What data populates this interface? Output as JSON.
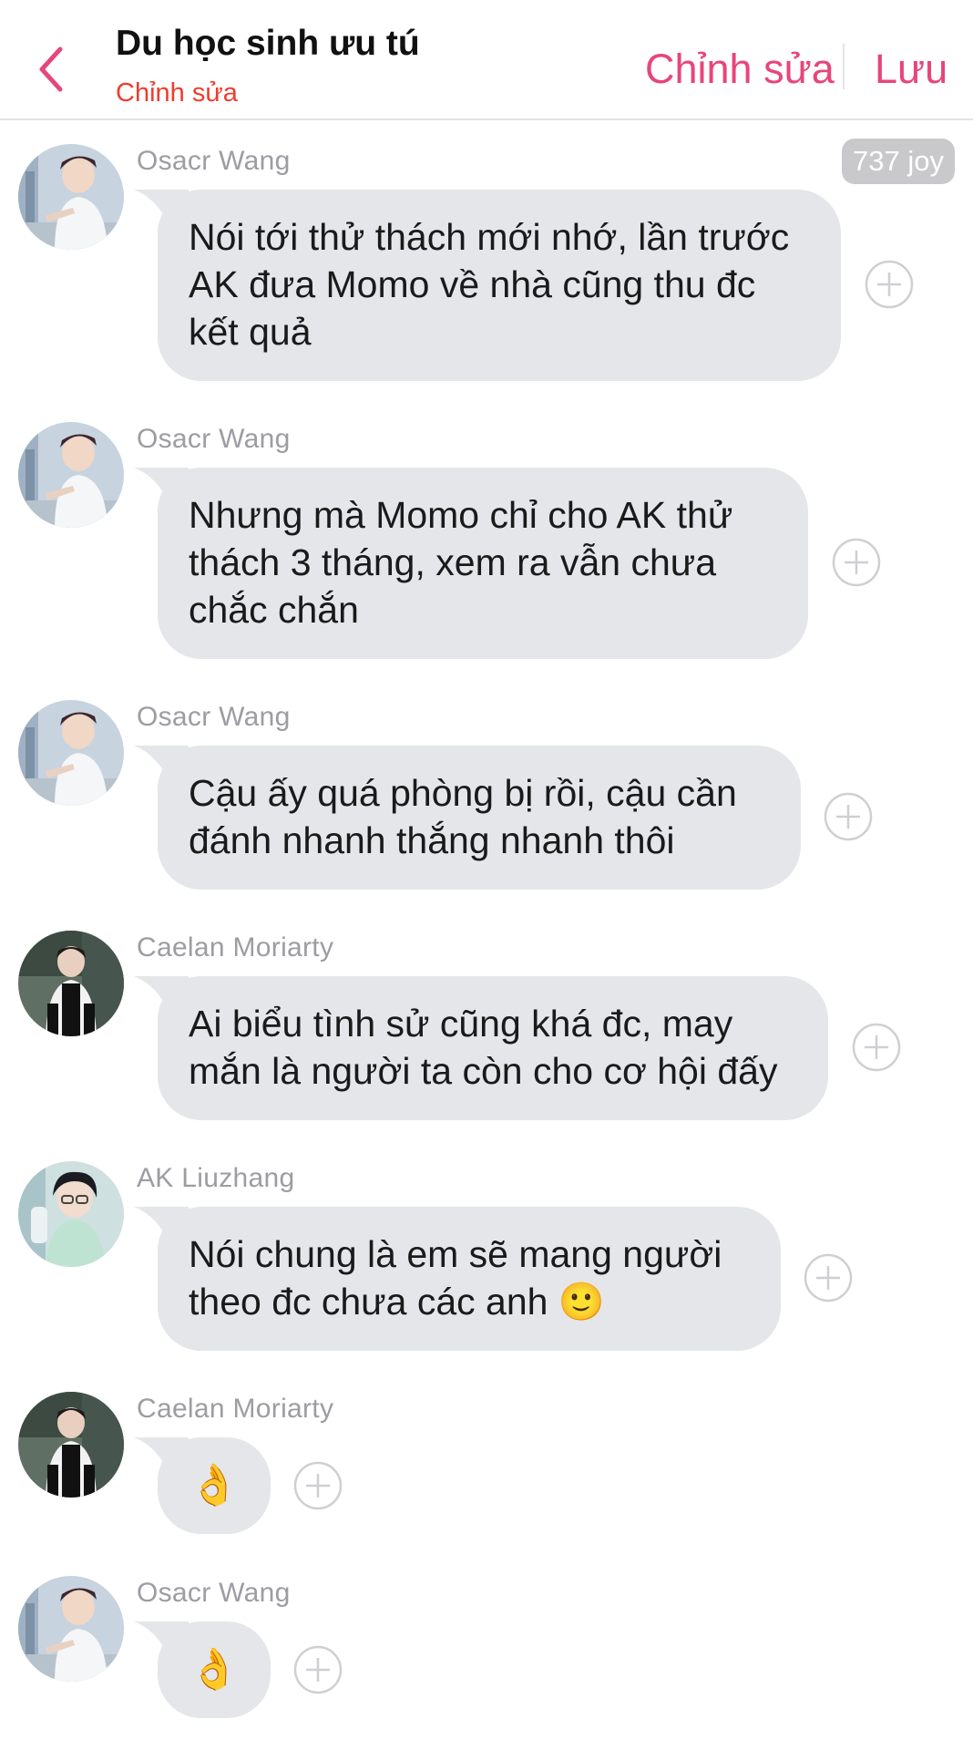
{
  "header": {
    "title": "Du học sinh ưu tú",
    "subtitle": "Chỉnh sửa",
    "edit_label": "Chỉnh sửa",
    "save_label": "Lưu",
    "back_icon": "chevron-left-icon",
    "accent": "#e8457a"
  },
  "joy_badge": "737 joy",
  "messages": [
    {
      "sender": "Osacr Wang",
      "text": "Nói tới thử thách mới nhớ, lần trước AK đưa Momo về nhà cũng thu đc kết quả",
      "avatar": "osacr"
    },
    {
      "sender": "Osacr Wang",
      "text": "Nhưng mà  Momo chỉ cho AK thử thách 3 tháng, xem ra vẫn chưa chắc chắn",
      "avatar": "osacr"
    },
    {
      "sender": "Osacr Wang",
      "text": "Cậu ấy quá phòng bị rồi, cậu cần đánh nhanh thắng nhanh thôi",
      "avatar": "osacr"
    },
    {
      "sender": "Caelan Moriarty",
      "text": "Ai biểu tình sử cũng khá đc, may mắn là người ta còn cho cơ hội đấy",
      "avatar": "caelan"
    },
    {
      "sender": "AK Liuzhang",
      "text": "Nói chung là em sẽ mang người theo đc chưa các anh 🙂",
      "avatar": "ak"
    },
    {
      "sender": "Caelan Moriarty",
      "text": "👌",
      "avatar": "caelan"
    },
    {
      "sender": "Osacr Wang",
      "text": "👌",
      "avatar": "osacr"
    }
  ],
  "colors": {
    "bubble": "#e4e6e9",
    "sender": "#9c9ca2",
    "subtitle": "#ef3c2d",
    "badge": "#c9c9cc"
  }
}
